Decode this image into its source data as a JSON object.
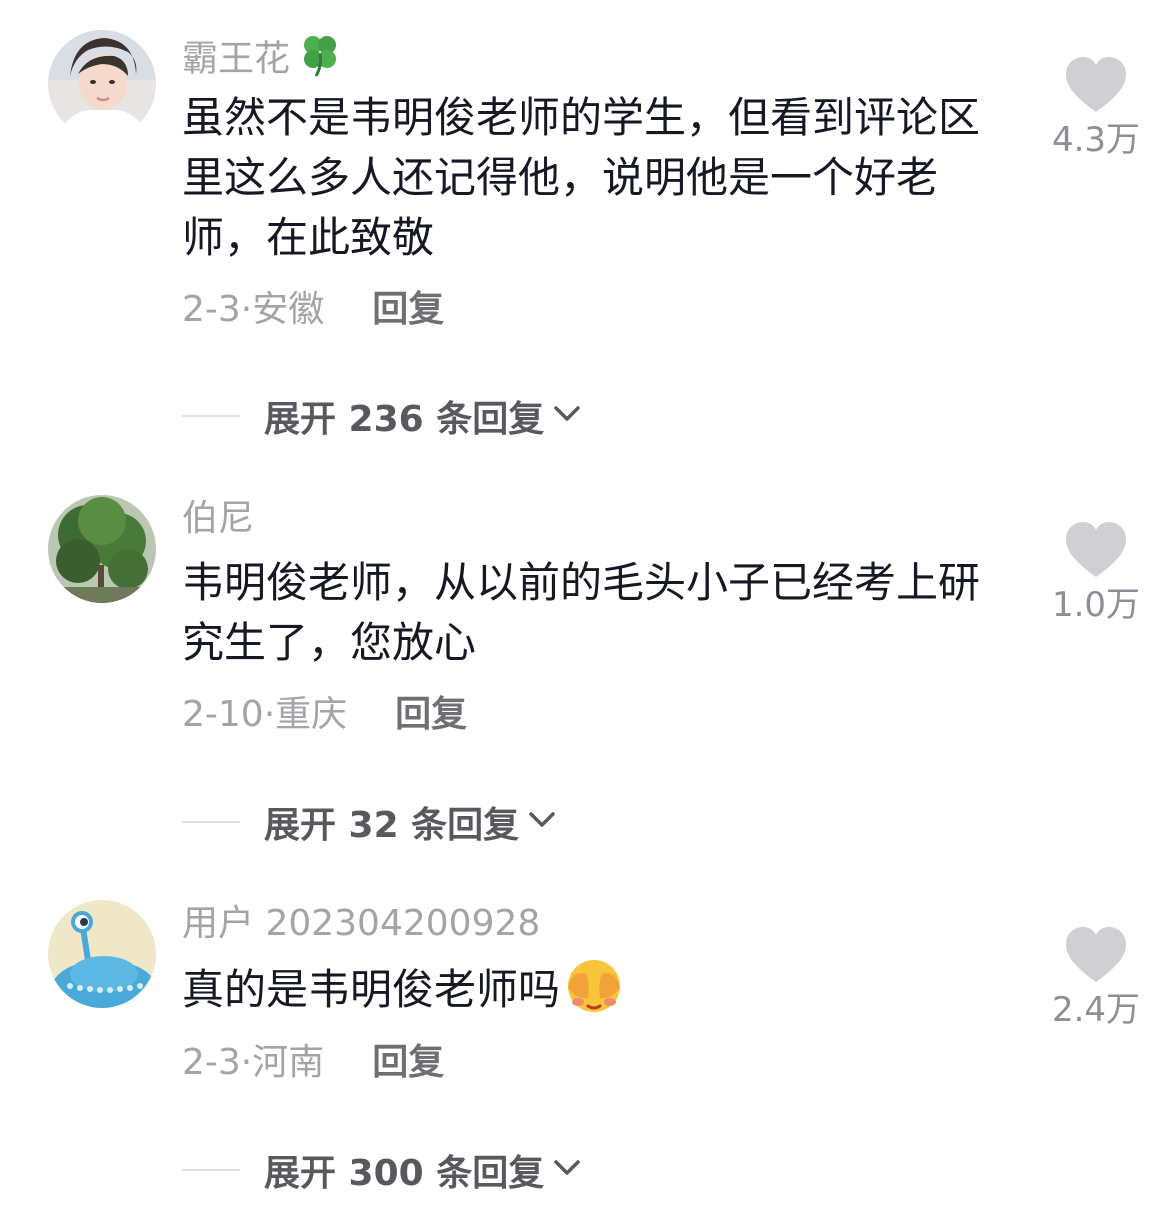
{
  "comments": [
    {
      "username": "霸王花",
      "text": "虽然不是韦明俊老师的学生，但看到评论区里这么多人还记得他，说明他是一个好老师，在此致敬",
      "date": "2-3·",
      "location": "安徽",
      "reply_label": "回复",
      "likes": "4.3万",
      "expand_label": "展开 236 条回复",
      "username_icon": "four-leaf-clover-icon"
    },
    {
      "username": "伯尼",
      "text": "韦明俊老师，从以前的毛头小子已经考上研究生了，您放心",
      "date": "2-10·",
      "location": "重庆",
      "reply_label": "回复",
      "likes": "1.0万",
      "expand_label": "展开 32 条回复"
    },
    {
      "username": "用户 202304200928",
      "text": "真的是韦明俊老师吗",
      "date": "2-3·",
      "location": "河南",
      "reply_label": "回复",
      "likes": "2.4万",
      "expand_label": "展开 300 条回复",
      "text_emoji": "face-with-hands-over-eyes-icon"
    }
  ],
  "colors": {
    "text": "#161823",
    "secondary": "#a3a3a8",
    "heart": "#d0d0d3"
  }
}
